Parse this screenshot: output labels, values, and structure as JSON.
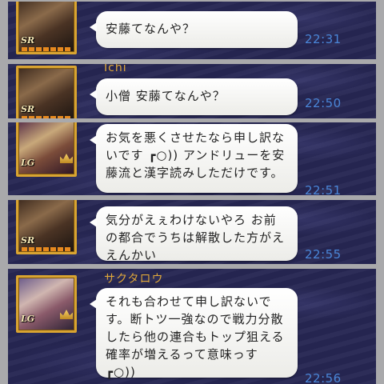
{
  "messages": [
    {
      "sender": "",
      "badge": "SR",
      "text": "安藤てなんや？",
      "time": "22:31"
    },
    {
      "sender": "Ichi",
      "badge": "SR",
      "text": "小僧 安藤てなんや？",
      "time": "22:50"
    },
    {
      "sender": "",
      "badge": "LG",
      "text": "お気を悪くさせたなら申し訳ないです ┏○)) アンドリューを安藤流と漢字読みしただけです。",
      "time": "22:51"
    },
    {
      "sender": "",
      "badge": "SR",
      "text": "気分がえぇわけないやろ お前の都合でうちは解散した方がええんかい",
      "time": "22:55"
    },
    {
      "sender": "サクタロウ",
      "badge": "LG",
      "text": "それも合わせて申し訳ないです。断トツ一強なので戦力分散したら他の連合もトップ狙える確率が増えるって意味っす ┏○))",
      "time": "22:56"
    }
  ]
}
